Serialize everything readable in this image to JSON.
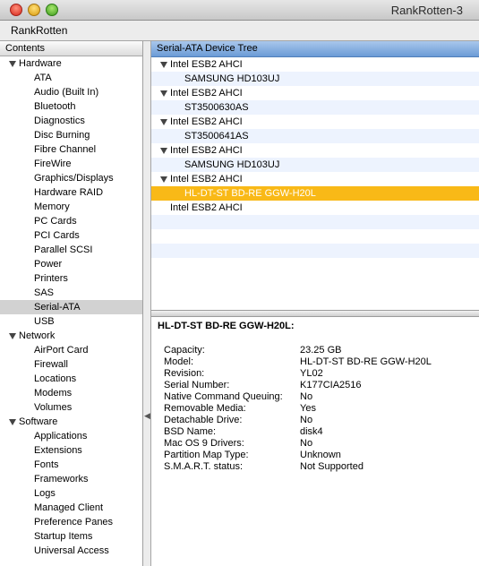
{
  "window": {
    "title": "RankRotten-3"
  },
  "appbar": {
    "label": "RankRotten"
  },
  "sidebar": {
    "header": "Contents",
    "groups": [
      {
        "label": "Hardware",
        "items": [
          "ATA",
          "Audio (Built In)",
          "Bluetooth",
          "Diagnostics",
          "Disc Burning",
          "Fibre Channel",
          "FireWire",
          "Graphics/Displays",
          "Hardware RAID",
          "Memory",
          "PC Cards",
          "PCI Cards",
          "Parallel SCSI",
          "Power",
          "Printers",
          "SAS",
          "Serial-ATA",
          "USB"
        ]
      },
      {
        "label": "Network",
        "items": [
          "AirPort Card",
          "Firewall",
          "Locations",
          "Modems",
          "Volumes"
        ]
      },
      {
        "label": "Software",
        "items": [
          "Applications",
          "Extensions",
          "Fonts",
          "Frameworks",
          "Logs",
          "Managed Client",
          "Preference Panes",
          "Startup Items",
          "Universal Access"
        ]
      }
    ],
    "selected": "Serial-ATA"
  },
  "device_tree": {
    "header": "Serial-ATA Device Tree",
    "rows": [
      {
        "label": "Intel ESB2 AHCI",
        "level": "parent"
      },
      {
        "label": "SAMSUNG HD103UJ",
        "level": "child"
      },
      {
        "label": "Intel ESB2 AHCI",
        "level": "parent"
      },
      {
        "label": "ST3500630AS",
        "level": "child"
      },
      {
        "label": "Intel ESB2 AHCI",
        "level": "parent"
      },
      {
        "label": "ST3500641AS",
        "level": "child"
      },
      {
        "label": "Intel ESB2 AHCI",
        "level": "parent"
      },
      {
        "label": "SAMSUNG HD103UJ",
        "level": "child"
      },
      {
        "label": "Intel ESB2 AHCI",
        "level": "parent"
      },
      {
        "label": "HL-DT-ST BD-RE  GGW-H20L",
        "level": "child",
        "selected": true
      },
      {
        "label": "Intel ESB2 AHCI",
        "level": "solo"
      }
    ],
    "selection_color": "#f9b917"
  },
  "details": {
    "title": "HL-DT-ST BD-RE  GGW-H20L:",
    "rows": [
      {
        "label": "Capacity:",
        "value": "23.25 GB"
      },
      {
        "label": "Model:",
        "value": "HL-DT-ST BD-RE  GGW-H20L"
      },
      {
        "label": "Revision:",
        "value": "YL02"
      },
      {
        "label": "Serial Number:",
        "value": "K177CIA2516"
      },
      {
        "label": "Native Command Queuing:",
        "value": "No"
      },
      {
        "label": "Removable Media:",
        "value": "Yes"
      },
      {
        "label": "Detachable Drive:",
        "value": "No"
      },
      {
        "label": "BSD Name:",
        "value": "disk4"
      },
      {
        "label": "Mac OS 9 Drivers:",
        "value": "No"
      },
      {
        "label": "Partition Map Type:",
        "value": "Unknown"
      },
      {
        "label": "S.M.A.R.T. status:",
        "value": "Not Supported"
      }
    ]
  }
}
